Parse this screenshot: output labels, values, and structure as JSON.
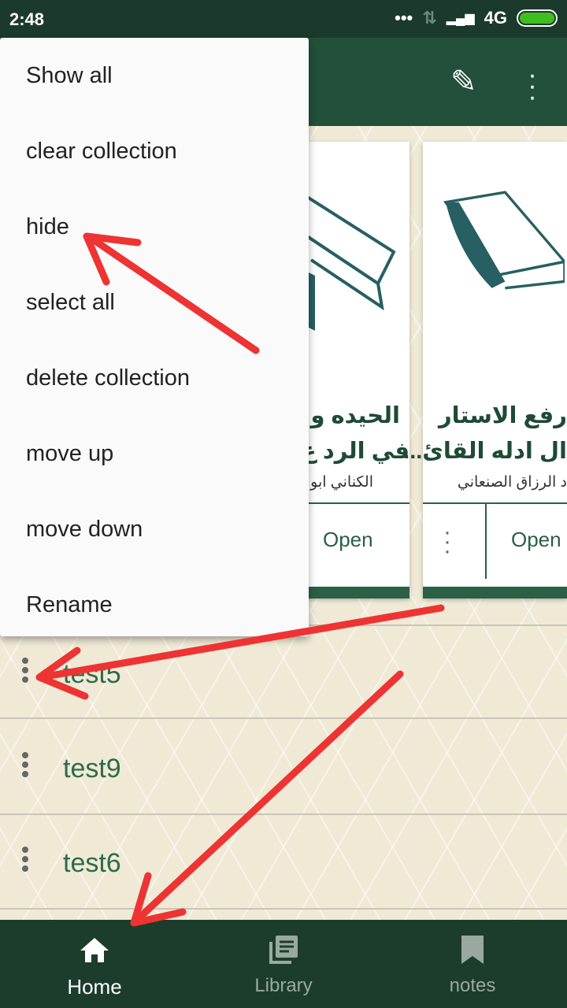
{
  "status": {
    "time": "2:48",
    "network": "4G",
    "battery_level": 1.0,
    "battery_color": "#3fbf1f"
  },
  "toolbar": {
    "icons": [
      "pencil-icon",
      "more-vert-icon"
    ]
  },
  "cards": [
    {
      "title_line1": "الحيده و",
      "title_line2": "في الرد ع",
      "author": "الكناني ابو",
      "open_label": "Open"
    },
    {
      "title_line1": "رفع الاستار",
      "title_line2": "ال ادله القائ...",
      "author": "د الرزاق الصنعاني",
      "open_label": "Open"
    }
  ],
  "collections": [
    {
      "label": "test5"
    },
    {
      "label": "test9"
    },
    {
      "label": "test6"
    }
  ],
  "menu": {
    "items": [
      "Show all",
      "clear collection",
      "hide",
      "select all",
      "delete collection",
      "move up",
      "move down",
      "Rename"
    ]
  },
  "nav": {
    "items": [
      {
        "label": "Home",
        "icon": "home-icon",
        "active": true
      },
      {
        "label": "Library",
        "icon": "library-icon"
      },
      {
        "label": "notes",
        "icon": "bookmark-icon"
      }
    ]
  },
  "colors": {
    "primary": "#22503a",
    "accent_text": "#2e6b4a",
    "annotation": "#ee3333"
  }
}
